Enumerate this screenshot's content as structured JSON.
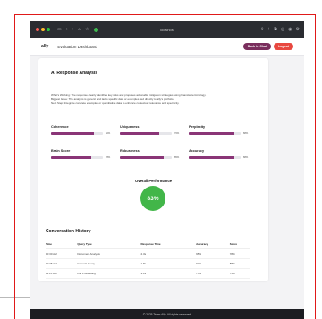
{
  "browser": {
    "address": "localhost",
    "traffic_colors": [
      "#ff5f57",
      "#febc2e",
      "#28c840"
    ]
  },
  "header": {
    "logo": "ally",
    "title": "Evaluation Dashboard",
    "back_label": "Back to Chat",
    "logout_label": "Logout"
  },
  "analysis": {
    "title": "AI Response Analysis",
    "lines": [
      "What's Working: The response clearly identifies key risks and proposes actionable mitigation strategies using financial terminology.",
      "Biggest Issue: The analysis is generic and lacks specific data or examples tied directly to ally's portfolio.",
      "Next Step: Integrate concrete examples or quantitative data to enhance contextual relevance and specificity."
    ]
  },
  "metrics": [
    {
      "label": "Coherence",
      "value": 82,
      "display": "82%"
    },
    {
      "label": "Uniqueness",
      "value": 76,
      "display": "76%"
    },
    {
      "label": "Perplexity",
      "value": 88,
      "display": "88%"
    },
    {
      "label": "Brain Score",
      "value": 78,
      "display": "78%"
    },
    {
      "label": "Robustness",
      "value": 85,
      "display": "85%"
    },
    {
      "label": "Accuracy",
      "value": 88,
      "display": "88%"
    }
  ],
  "performance": {
    "title": "Overall Performance",
    "score": "83%",
    "color": "#42b649"
  },
  "history": {
    "title": "Conversation History",
    "columns": [
      "Time",
      "Query Type",
      "Response Time",
      "Accuracy",
      "Score"
    ],
    "rows": [
      [
        "10:30 AM",
        "Document Analysis",
        "2.3s",
        "95%",
        "78%"
      ],
      [
        "10:35 AM",
        "General Query",
        "1.8s",
        "92%",
        "88%"
      ],
      [
        "11:15 AM",
        "File Processing",
        "3.1s",
        "75%",
        "75%"
      ]
    ]
  },
  "footer": {
    "text": "© 2025 Team Ally. All rights reserved."
  }
}
